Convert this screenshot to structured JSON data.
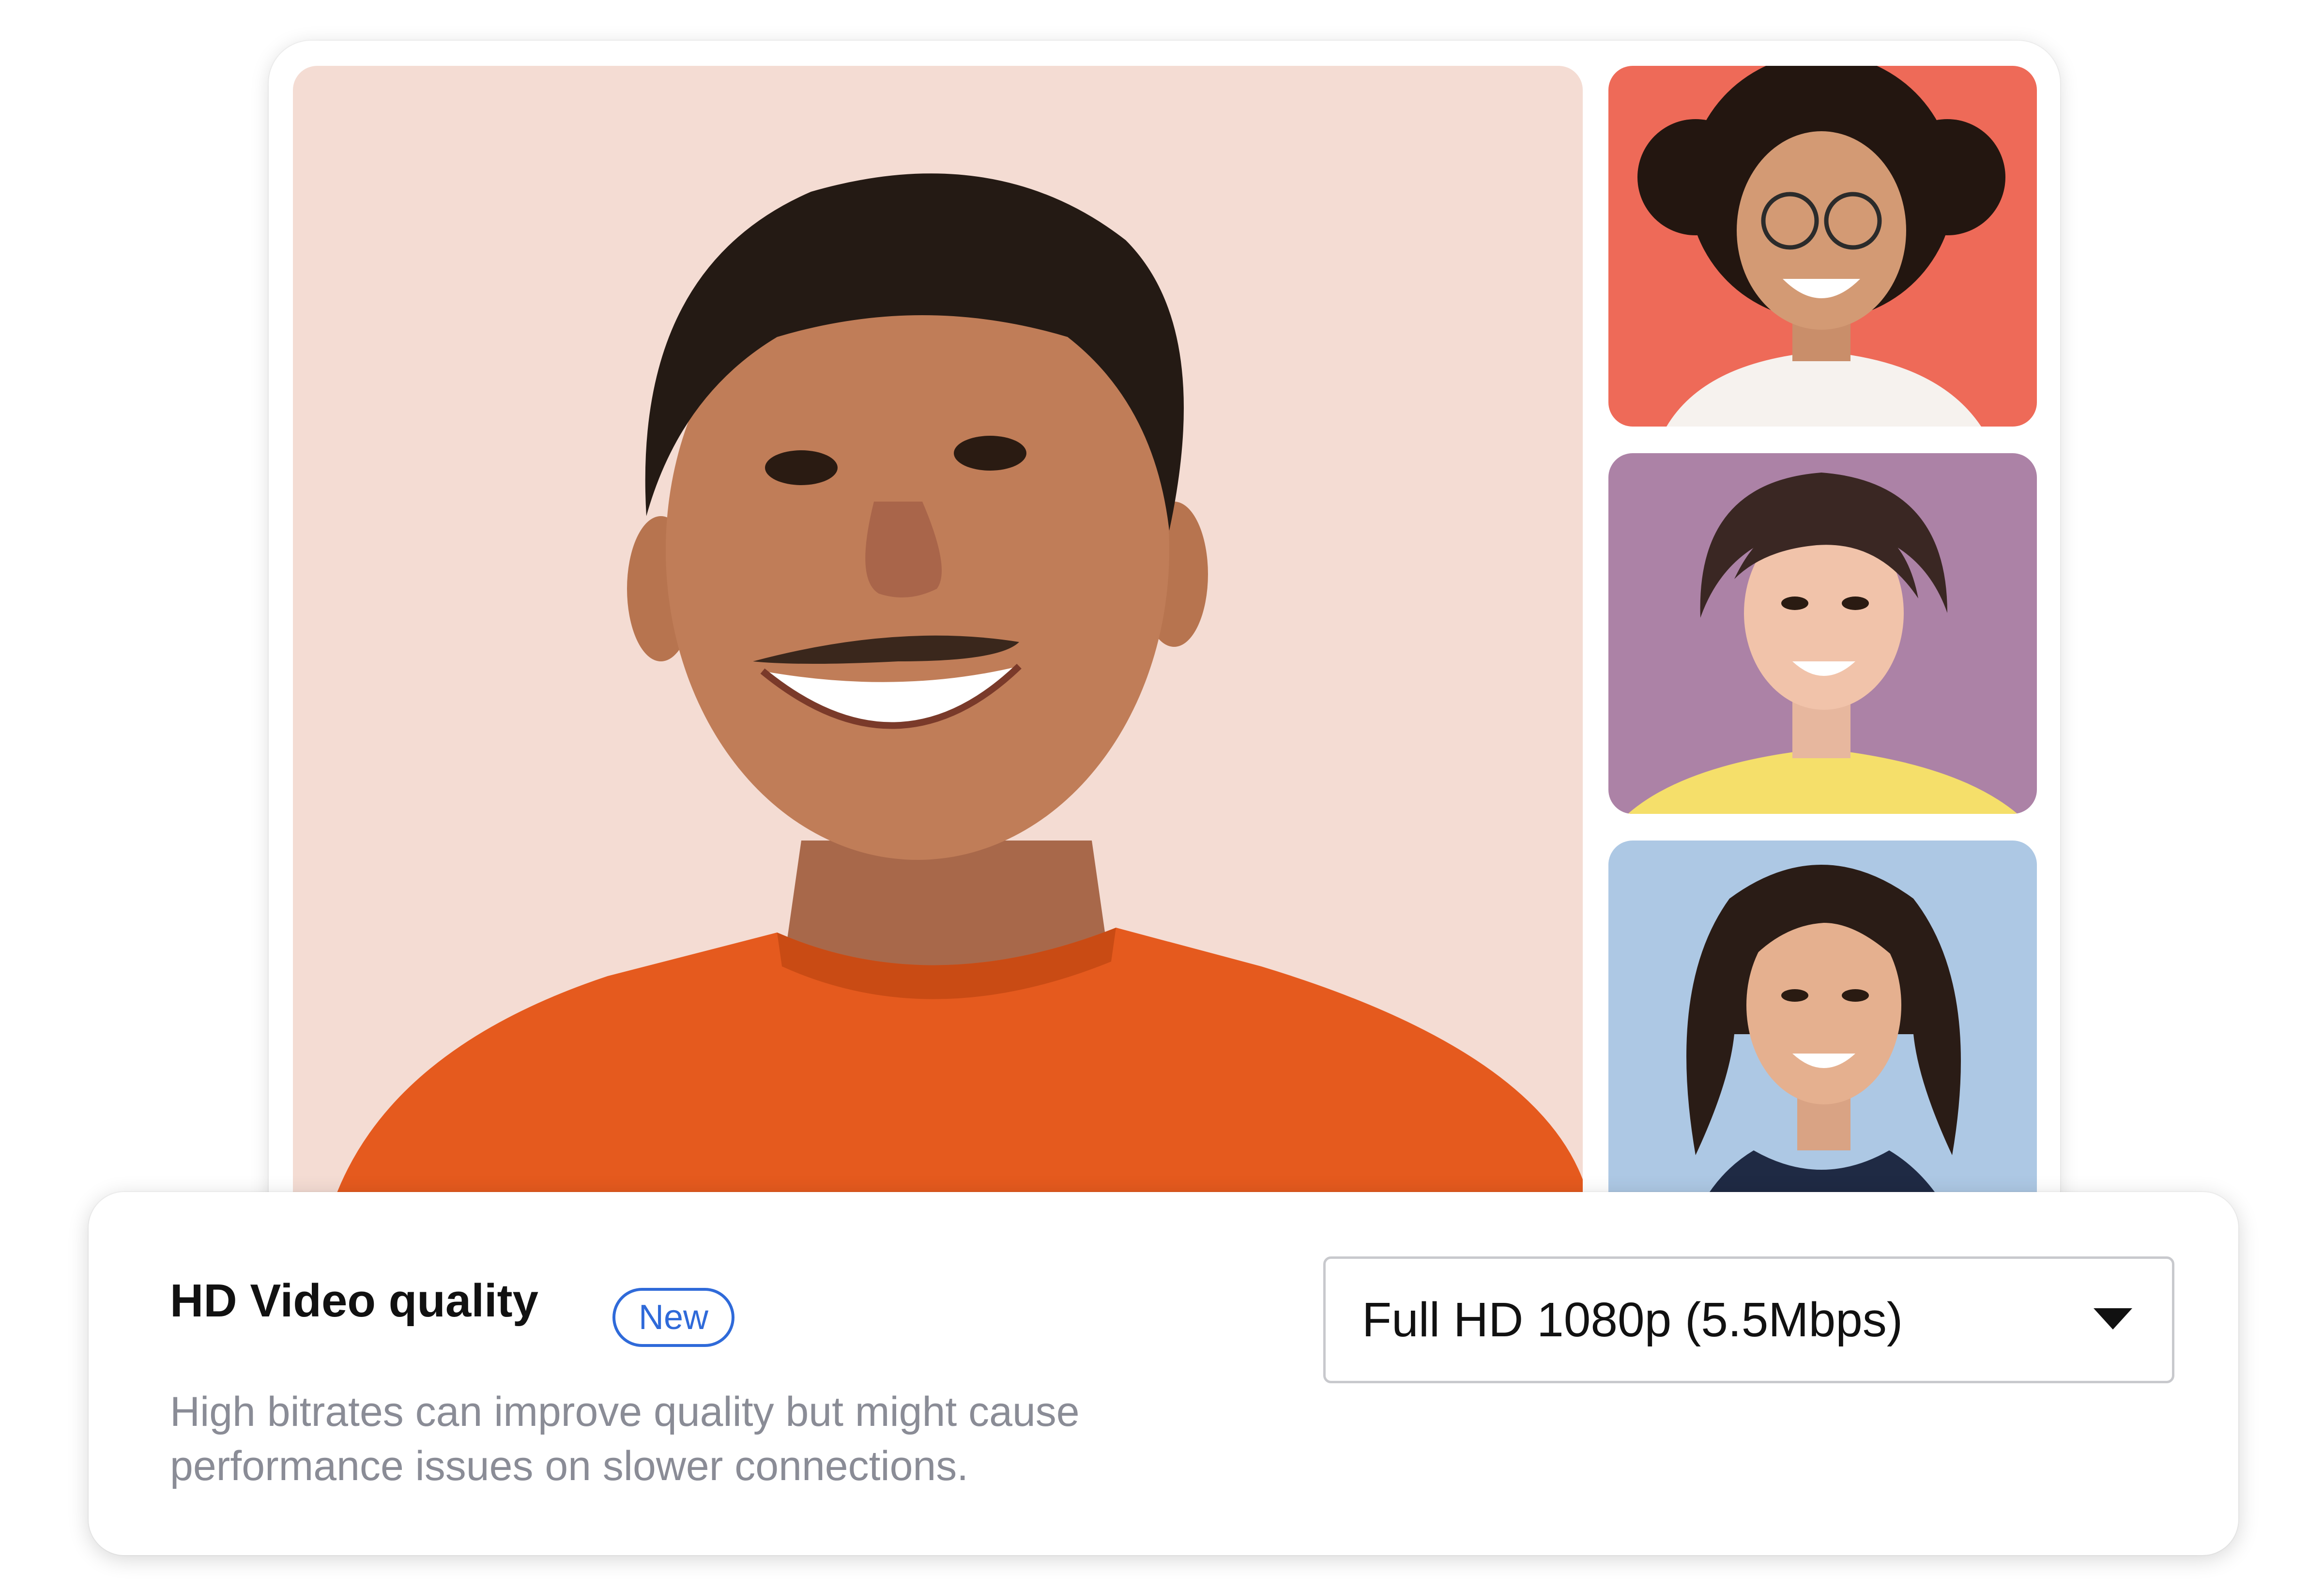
{
  "video_call": {
    "participants": [
      {
        "role": "main-speaker",
        "tile_color": "#f4dcd3",
        "shirt_color": "#e55a1e"
      },
      {
        "role": "participant",
        "tile_color": "#ee6a58",
        "shirt_color": "#f6f2ee"
      },
      {
        "role": "participant",
        "tile_color": "#ac82a6",
        "shirt_color": "#f5df6a"
      },
      {
        "role": "participant",
        "tile_color": "#adc8e4",
        "shirt_color": "#1f2a44"
      }
    ]
  },
  "settings": {
    "title": "HD Video quality",
    "badge": "New",
    "description": "High bitrates can improve quality but might cause performance issues on slower connections.",
    "select": {
      "value": "Full HD 1080p (5.5Mbps)",
      "icon": "chevron-down-icon"
    },
    "accent_color": "#2f6ad9"
  }
}
